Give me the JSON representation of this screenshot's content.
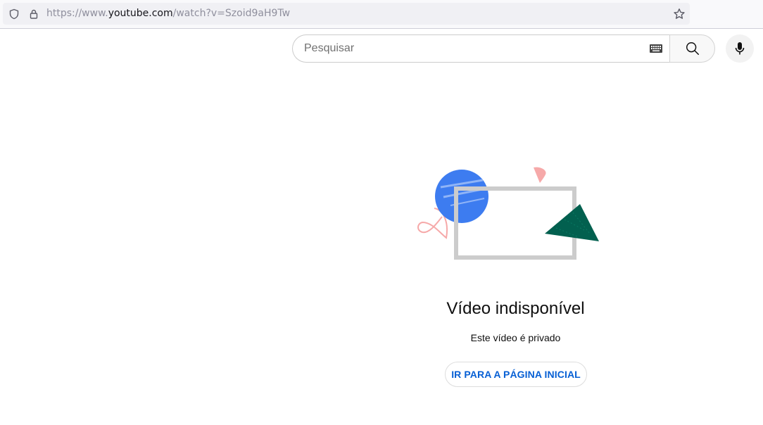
{
  "browser": {
    "url_prefix": "https://www.",
    "url_domain": "youtube.com",
    "url_path": "/watch?v=Szoid9aH9Tw"
  },
  "header": {
    "search_placeholder": "Pesquisar",
    "search_value": ""
  },
  "error": {
    "title": "Vídeo indisponível",
    "message": "Este vídeo é privado",
    "home_button_label": "IR PARA A PÁGINA INICIAL"
  },
  "colors": {
    "link_blue": "#065fd4",
    "illustration_blue": "#3d7cf0",
    "illustration_green": "#02604f",
    "illustration_pink": "#f6a9a9"
  }
}
